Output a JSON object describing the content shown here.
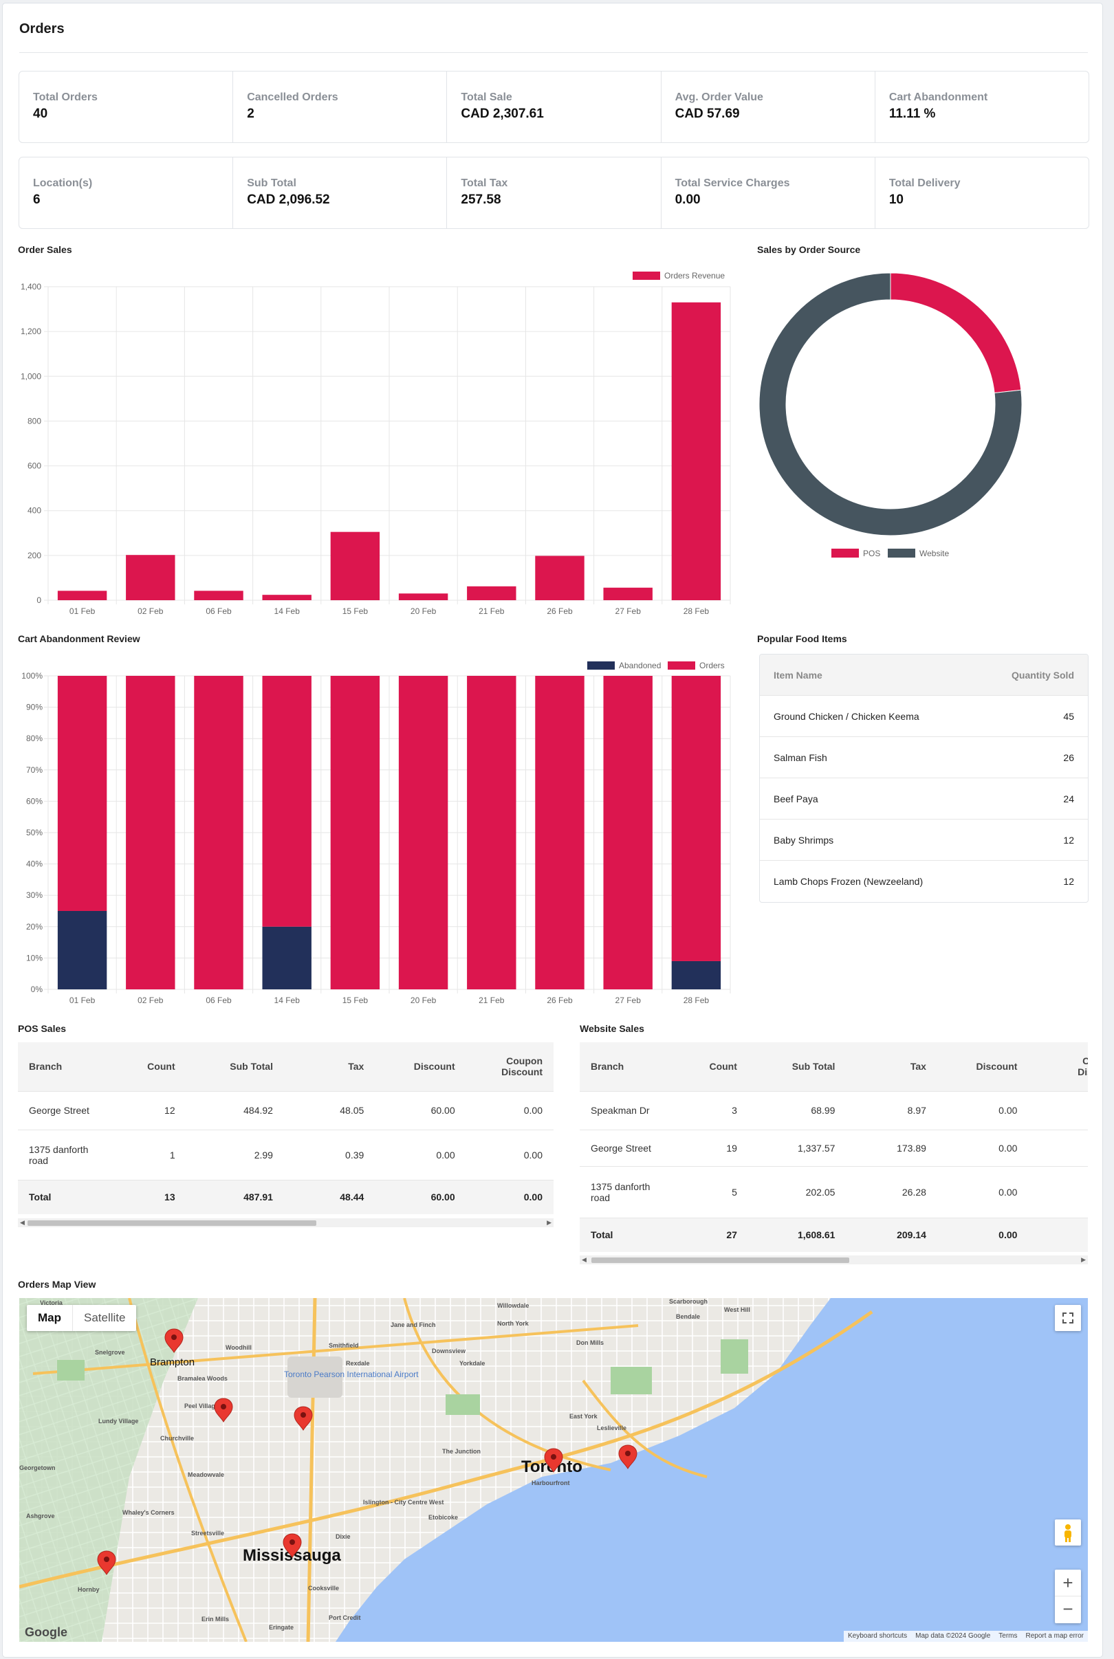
{
  "page": {
    "title": "Orders"
  },
  "stats_row1": [
    {
      "label": "Total Orders",
      "value": "40"
    },
    {
      "label": "Cancelled Orders",
      "value": "2"
    },
    {
      "label": "Total Sale",
      "value": "CAD 2,307.61"
    },
    {
      "label": "Avg. Order Value",
      "value": "CAD 57.69"
    },
    {
      "label": "Cart Abandonment",
      "value": "11.11 %"
    }
  ],
  "stats_row2": [
    {
      "label": "Location(s)",
      "value": "6"
    },
    {
      "label": "Sub Total",
      "value": "CAD 2,096.52"
    },
    {
      "label": "Total Tax",
      "value": "257.58"
    },
    {
      "label": "Total Service Charges",
      "value": "0.00"
    },
    {
      "label": "Total Delivery",
      "value": "10"
    }
  ],
  "sections": {
    "order_sales": "Order Sales",
    "sales_by_source": "Sales by Order Source",
    "cart_abandonment": "Cart Abandonment Review",
    "popular_food": "Popular Food Items",
    "pos_sales": "POS Sales",
    "website_sales": "Website Sales",
    "map_view": "Orders Map View"
  },
  "chart_data": [
    {
      "type": "bar",
      "categories": [
        "01 Feb",
        "02 Feb",
        "06 Feb",
        "14 Feb",
        "15 Feb",
        "20 Feb",
        "21 Feb",
        "26 Feb",
        "27 Feb",
        "28 Feb"
      ],
      "series": [
        {
          "name": "Orders Revenue",
          "values": [
            42,
            202,
            42,
            24,
            305,
            30,
            62,
            198,
            56,
            1330
          ]
        }
      ],
      "ylim": [
        0,
        1400
      ],
      "yticks": [
        "0",
        "200",
        "400",
        "600",
        "800",
        "1,000",
        "1,200",
        "1,400"
      ],
      "grid": true,
      "legend": "top-right",
      "color": "#dc164e"
    },
    {
      "type": "pie",
      "donut": true,
      "series": [
        {
          "name": "POS",
          "value": 487.91,
          "color": "#dc164e"
        },
        {
          "name": "Website",
          "value": 1608.61,
          "color": "#46555f"
        }
      ],
      "legend": "bottom"
    },
    {
      "type": "bar",
      "stacked": true,
      "categories": [
        "01 Feb",
        "02 Feb",
        "06 Feb",
        "14 Feb",
        "15 Feb",
        "20 Feb",
        "21 Feb",
        "26 Feb",
        "27 Feb",
        "28 Feb"
      ],
      "series": [
        {
          "name": "Abandoned",
          "values": [
            25,
            0,
            0,
            20,
            0,
            0,
            0,
            0,
            0,
            9
          ],
          "color": "#22305a"
        },
        {
          "name": "Orders",
          "values": [
            75,
            100,
            100,
            80,
            100,
            100,
            100,
            100,
            100,
            91
          ],
          "color": "#dc164e"
        }
      ],
      "ylim": [
        0,
        100
      ],
      "yticks": [
        "0%",
        "10%",
        "20%",
        "30%",
        "40%",
        "50%",
        "60%",
        "70%",
        "80%",
        "90%",
        "100%"
      ],
      "grid": true,
      "legend": "top-right"
    }
  ],
  "popular_food": {
    "headers": {
      "name": "Item Name",
      "qty": "Quantity Sold"
    },
    "rows": [
      {
        "name": "Ground Chicken / Chicken Keema",
        "qty": "45"
      },
      {
        "name": "Salman Fish",
        "qty": "26"
      },
      {
        "name": "Beef Paya",
        "qty": "24"
      },
      {
        "name": "Baby Shrimps",
        "qty": "12"
      },
      {
        "name": "Lamb Chops Frozen (Newzeeland)",
        "qty": "12"
      }
    ]
  },
  "pos_table": {
    "headers": [
      "Branch",
      "Count",
      "Sub Total",
      "Tax",
      "Discount",
      "Coupon Discount"
    ],
    "rows": [
      [
        "George Street",
        "12",
        "484.92",
        "48.05",
        "60.00",
        "0.00"
      ],
      [
        "1375 danforth road",
        "1",
        "2.99",
        "0.39",
        "0.00",
        "0.00"
      ]
    ],
    "total": [
      "Total",
      "13",
      "487.91",
      "48.44",
      "60.00",
      "0.00"
    ]
  },
  "website_table": {
    "headers": [
      "Branch",
      "Count",
      "Sub Total",
      "Tax",
      "Discount",
      "Coupon Discount"
    ],
    "rows": [
      [
        "Speakman Dr",
        "3",
        "68.99",
        "8.97",
        "0.00",
        ""
      ],
      [
        "George Street",
        "19",
        "1,337.57",
        "173.89",
        "0.00",
        ""
      ],
      [
        "1375 danforth road",
        "5",
        "202.05",
        "26.28",
        "0.00",
        ""
      ]
    ],
    "total": [
      "Total",
      "27",
      "1,608.61",
      "209.14",
      "0.00",
      ""
    ]
  },
  "map": {
    "buttons": {
      "map": "Map",
      "satellite": "Satellite"
    },
    "cities": [
      "Brampton",
      "Toronto",
      "Mississauga"
    ],
    "places": [
      "Woodhill",
      "Toronto Pearson International Airport",
      "North York",
      "Scarborough",
      "East York",
      "Etobicoke",
      "Bramalea Woods",
      "Peel Village",
      "Churchville",
      "Meadowvale",
      "Streetsville",
      "Whaley's Corners",
      "Ashgrove",
      "Hornby",
      "Cooksville",
      "Erin Mills",
      "Don Mills",
      "Downsview",
      "Rexdale",
      "Smithfield",
      "Lundy Village",
      "Snelgrove",
      "Victoria",
      "Willowdale",
      "Bendale",
      "West Hill",
      "Leslieville",
      "The Junction",
      "Harbourfront",
      "Islington - City Centre West",
      "Port Credit",
      "Jane and Finch",
      "Yorkdale",
      "Dixie",
      "Eringate",
      "Georgetown"
    ],
    "footer": [
      "Keyboard shortcuts",
      "Map data ©2024 Google",
      "Terms",
      "Report a map error"
    ],
    "logo": "Google"
  }
}
